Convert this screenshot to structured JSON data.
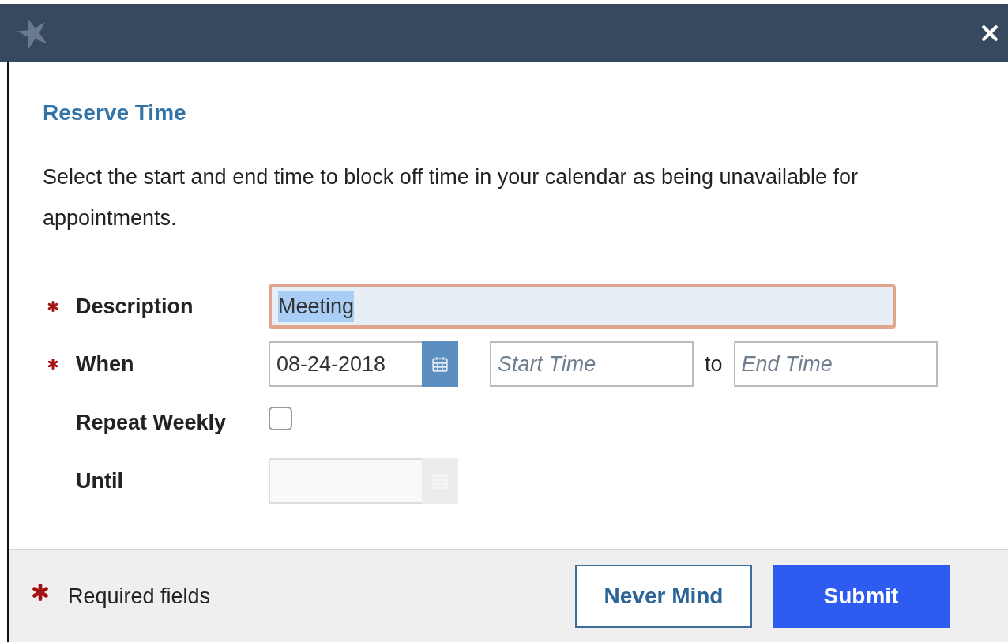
{
  "dialog": {
    "title": "Reserve Time",
    "intro": "Select the start and end time to block off time in your calendar as being unavailable for appointments."
  },
  "form": {
    "description": {
      "label": "Description",
      "required": true,
      "value": "Meeting",
      "focused": true,
      "text_selected": true
    },
    "when": {
      "label": "When",
      "required": true,
      "date": "08-24-2018",
      "start_placeholder": "Start Time",
      "separator": "to",
      "end_placeholder": "End Time"
    },
    "repeat_weekly": {
      "label": "Repeat Weekly",
      "required": false,
      "checked": false
    },
    "until": {
      "label": "Until",
      "required": false,
      "disabled": true
    }
  },
  "footer": {
    "legend": "Required fields",
    "buttons": [
      {
        "label": "Never Mind",
        "kind": "secondary"
      },
      {
        "label": "Submit",
        "kind": "primary"
      }
    ]
  }
}
